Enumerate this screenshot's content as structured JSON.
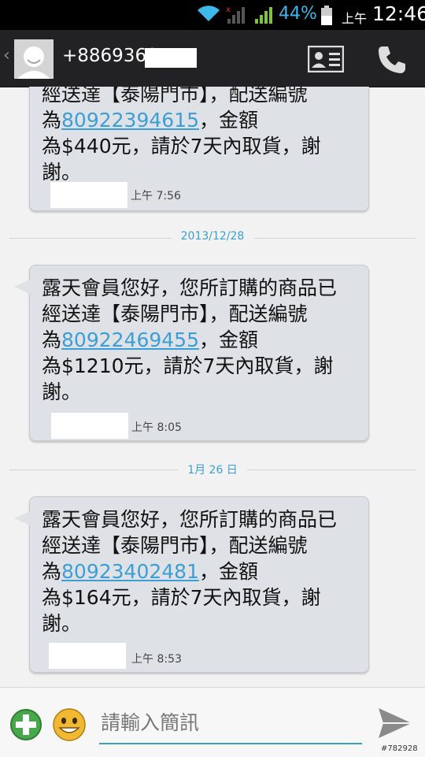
{
  "status_bar": {
    "battery_percent": "44%",
    "ampm": "上午",
    "time": "12:46",
    "icons": [
      "wifi-icon",
      "signal-no-sim-icon",
      "signal-icon",
      "battery-icon"
    ]
  },
  "header": {
    "contact": "+8869360",
    "icons": [
      "back-icon",
      "avatar",
      "contact-card-icon",
      "phone-icon"
    ]
  },
  "messages": [
    {
      "lines": [
        "經送達【泰陽門市】，配送編號"
      ],
      "prefix": "為",
      "number": "80922394615",
      "suffix": "，金額",
      "line3": "為$440元，請於7天內取貨，謝",
      "line4": "謝。",
      "time": "上午 7:56"
    },
    {
      "line1": "露天會員您好，您所訂購的商品已",
      "line2": "經送達【泰陽門市】，配送編號",
      "prefix": "為",
      "number": "80922469455",
      "suffix": "，金額",
      "line4": "為$1210元，請於7天內取貨，謝",
      "line5": "謝。",
      "time": "上午 8:05"
    },
    {
      "line1": "露天會員您好，您所訂購的商品已",
      "line2": "經送達【泰陽門市】，配送編號",
      "prefix": "為",
      "number": "80923402481",
      "suffix": "，金額",
      "line4": "為$164元，請於7天內取貨，謝",
      "line5": "謝。",
      "time": "上午 8:53"
    }
  ],
  "date_separators": [
    "2013/12/28",
    "1月 26 日"
  ],
  "input": {
    "placeholder": "請輸入簡訊"
  },
  "watermark": "#782928",
  "colors": {
    "accent": "#3b9ed6",
    "bubble": "#dee2e6",
    "header": "#222224"
  }
}
